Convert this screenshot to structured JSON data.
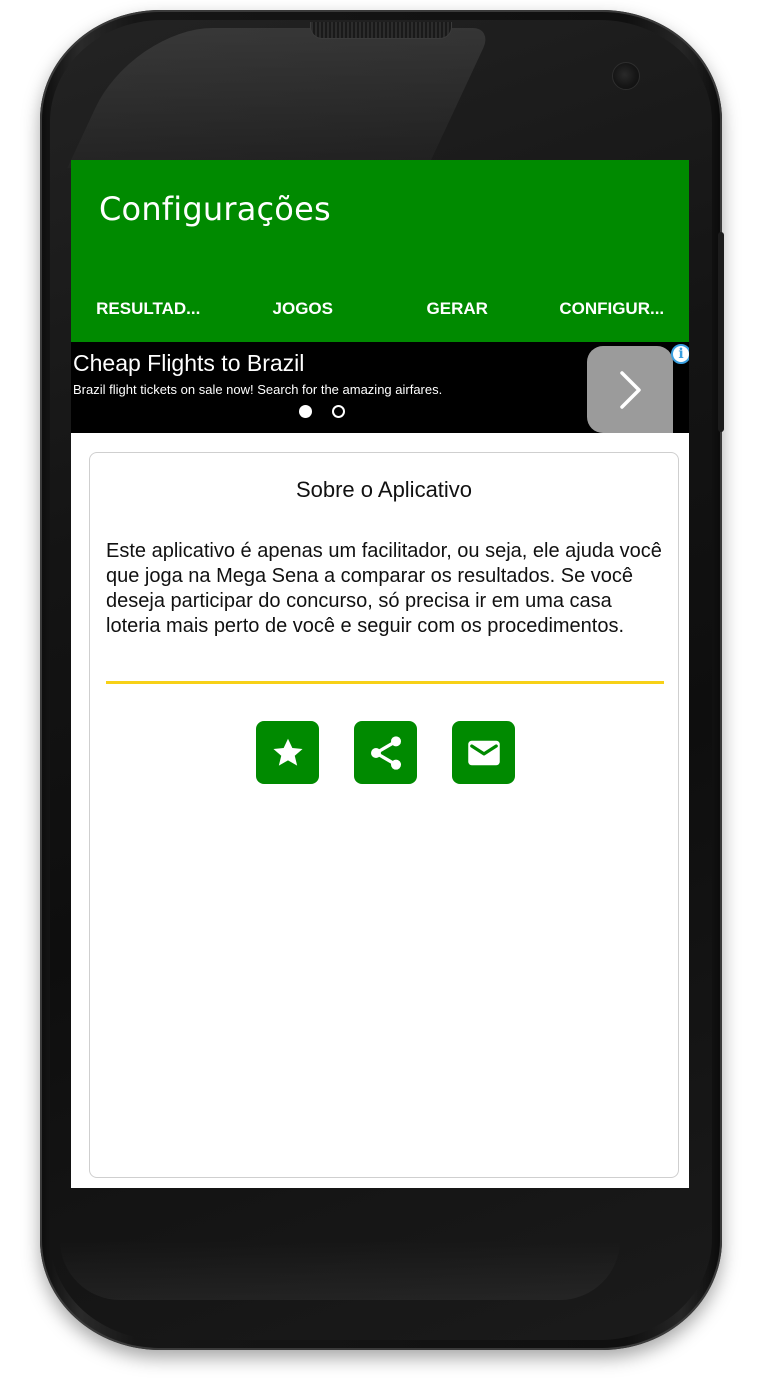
{
  "app": {
    "title": "Configurações",
    "accent_color": "#008a00",
    "indicator_color": "#f7d117"
  },
  "tabs": [
    {
      "label": "RESULTAD..."
    },
    {
      "label": "JOGOS"
    },
    {
      "label": "GERAR"
    },
    {
      "label": "CONFIGUR...",
      "active": true
    }
  ],
  "ad": {
    "title": "Cheap Flights to Brazil",
    "description": "Brazil flight tickets on sale now! Search for the amazing airfares.",
    "next_icon": "chevron-right-icon",
    "info_icon": "info-icon",
    "info_label": "i"
  },
  "about": {
    "title": "Sobre o Aplicativo",
    "text": "Este aplicativo é apenas um facilitador, ou seja, ele ajuda você que joga na Mega Sena a comparar os resultados. Se você deseja participar do concurso, só precisa ir em uma casa loteria mais perto de você e seguir com os procedimentos."
  },
  "actions": [
    {
      "icon": "star-icon"
    },
    {
      "icon": "share-icon"
    },
    {
      "icon": "mail-icon"
    }
  ]
}
